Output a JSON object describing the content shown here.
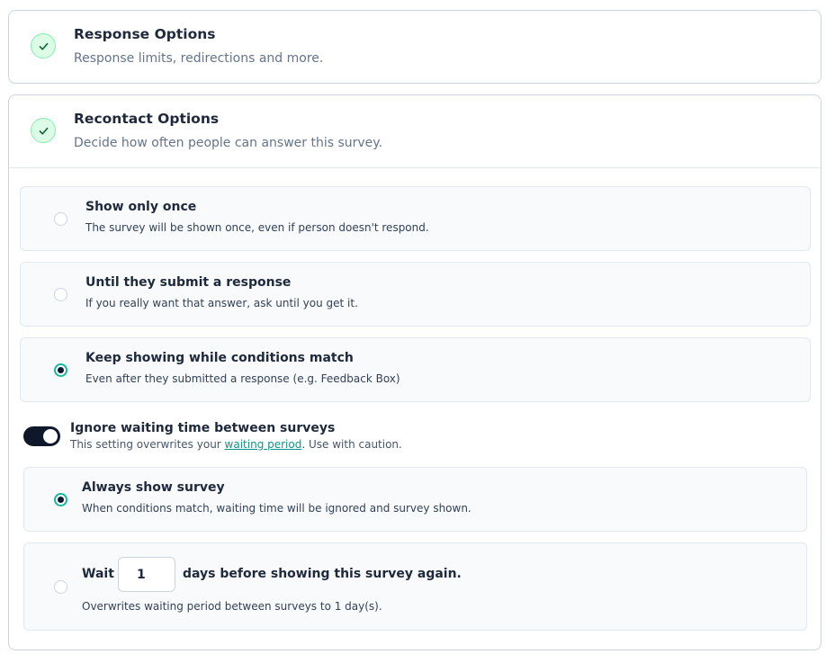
{
  "response_options": {
    "title": "Response Options",
    "subtitle": "Response limits, redirections and more."
  },
  "recontact_options": {
    "title": "Recontact Options",
    "subtitle": "Decide how often people can answer this survey.",
    "options": [
      {
        "title": "Show only once",
        "description": "The survey will be shown once, even if person doesn't respond.",
        "selected": false
      },
      {
        "title": "Until they submit a response",
        "description": "If you really want that answer, ask until you get it.",
        "selected": false
      },
      {
        "title": "Keep showing while conditions match",
        "description": "Even after they submitted a response (e.g. Feedback Box)",
        "selected": true
      }
    ],
    "ignore_waiting": {
      "enabled": true,
      "title": "Ignore waiting time between surveys",
      "desc_prefix": "This setting overwrites your ",
      "desc_link": "waiting period",
      "desc_suffix": ". Use with caution."
    },
    "waiting_options": [
      {
        "title": "Always show survey",
        "description": "When conditions match, waiting time will be ignored and survey shown.",
        "selected": true
      },
      {
        "title_before": "Wait",
        "days_value": "1",
        "title_after": "days before showing this survey again.",
        "description": "Overwrites waiting period between surveys to 1 day(s).",
        "selected": false
      }
    ]
  },
  "colors": {
    "accent": "#14b8a6",
    "success_bg": "#dcfce7",
    "toggle_on": "#0f172a"
  },
  "icons": {
    "completed": "check-icon"
  }
}
